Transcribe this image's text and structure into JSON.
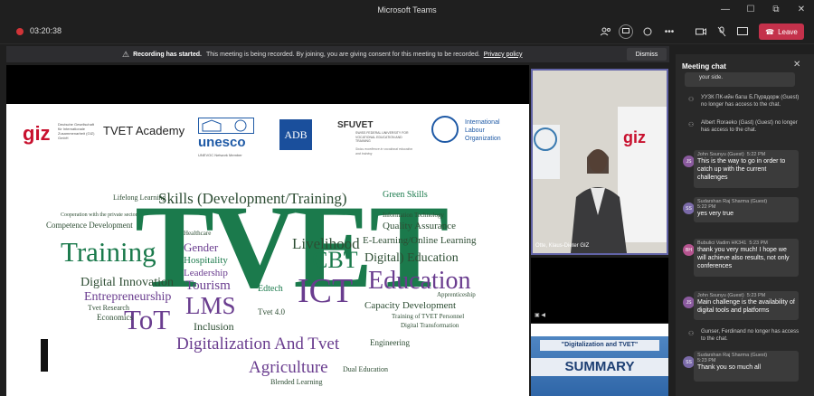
{
  "window": {
    "title": "Microsoft Teams",
    "controls": [
      "—",
      "☐",
      "⧉",
      "✕"
    ]
  },
  "toolbar": {
    "timer": "03:20:38",
    "leave_label": "Leave"
  },
  "banner": {
    "bold": "Recording has started.",
    "text": "This meeting is being recorded. By joining, you are giving consent for this meeting to be recorded.",
    "link": "Privacy policy",
    "dismiss": "Dismiss"
  },
  "logos": {
    "giz": "giz",
    "giz_sub": "Deutsche Gesellschaft für Internationale Zusammenarbeit (GIZ) GmbH",
    "tvet": "TVET Academy",
    "unesco": "unesco",
    "unesco_sub": "UNEVOC Network Member",
    "adb": "ADB",
    "sfuvet": "SFUVET",
    "sfuvet_sub": "SWISS FEDERAL UNIVERSITY FOR VOCATIONAL EDUCATION AND TRAINING",
    "sfuvet_tag": "Swiss excellence in vocational education and training",
    "ilo": "International Labour Organization"
  },
  "wordcloud": {
    "big": "TVET",
    "words": [
      "Skills (Development/Training)",
      "Training",
      "Gender",
      "Hospitality",
      "Leadership",
      "Digital Innovation",
      "Entrepreneurship",
      "ToT",
      "Tourism",
      "LMS",
      "Inclusion",
      "Livelihood",
      "CBT",
      "ICT",
      "Edtech",
      "Education",
      "Digital) Education",
      "E-Learning/Online Learning",
      "Quality Assurance",
      "Capacity Development",
      "Digitalization And Tvet",
      "Agriculture",
      "Competence Development",
      "Green Skills",
      "Information Technology",
      "Engineering",
      "Economics",
      "Tvet Research",
      "Lifelong Learning",
      "Cooperation with the private sector",
      "Healthcare",
      "Blended Learning",
      "Dual Education",
      "Tvet 4.0",
      "Training of TVET Personnel",
      "Digital Transformation",
      "Apprenticeship"
    ]
  },
  "video": {
    "participant": "Otte, Klaus-Dieter GIZ"
  },
  "thumb2": {
    "caption": "\"Digitalization and TVET\"",
    "title": "SUMMARY"
  },
  "chat": {
    "title": "Meeting chat",
    "top_fragment": "your side.",
    "sys1": "УУЗК ПК-ийн багш Б.Пүрвдорж (Guest) no longer has access to the chat.",
    "sys2": "Albert Roraeko (Gast) (Guest) no longer has access to the chat.",
    "m1_initials": "JS",
    "m1_name": "John Ssunyu (Guest)",
    "m1_time": "5:22 PM",
    "m1_text": "This is the way to go in order to catch up with the current challenges",
    "m2_initials": "SS",
    "m2_name": "Sudarshan Raj Sharma (Guest)",
    "m2_time": "5:22 PM",
    "m2_text": "yes very true",
    "m3_initials": "BH",
    "m3_name": "Bubulici Vadim HK341",
    "m3_time": "5:23 PM",
    "m3_text": "thank you very much! I hope we will achieve also results, not only conferences",
    "m4_initials": "JS",
    "m4_name": "John Ssunyu (Guest)",
    "m4_time": "5:23 PM",
    "m4_text": "Main challenge is the availability of digital tools and platforms",
    "sys3": "Gunser, Ferdinand no longer has access to the chat.",
    "m5_initials": "SS",
    "m5_name": "Sudarshan Raj Sharma (Guest)",
    "m5_time": "5:23 PM",
    "m5_text": "Thank you so much all"
  },
  "colors": {
    "accent": "#6264a7",
    "leave": "#c4314b",
    "record": "#d13438",
    "cloud_green": "#1b7a4c",
    "cloud_purple": "#6a3d8f"
  }
}
